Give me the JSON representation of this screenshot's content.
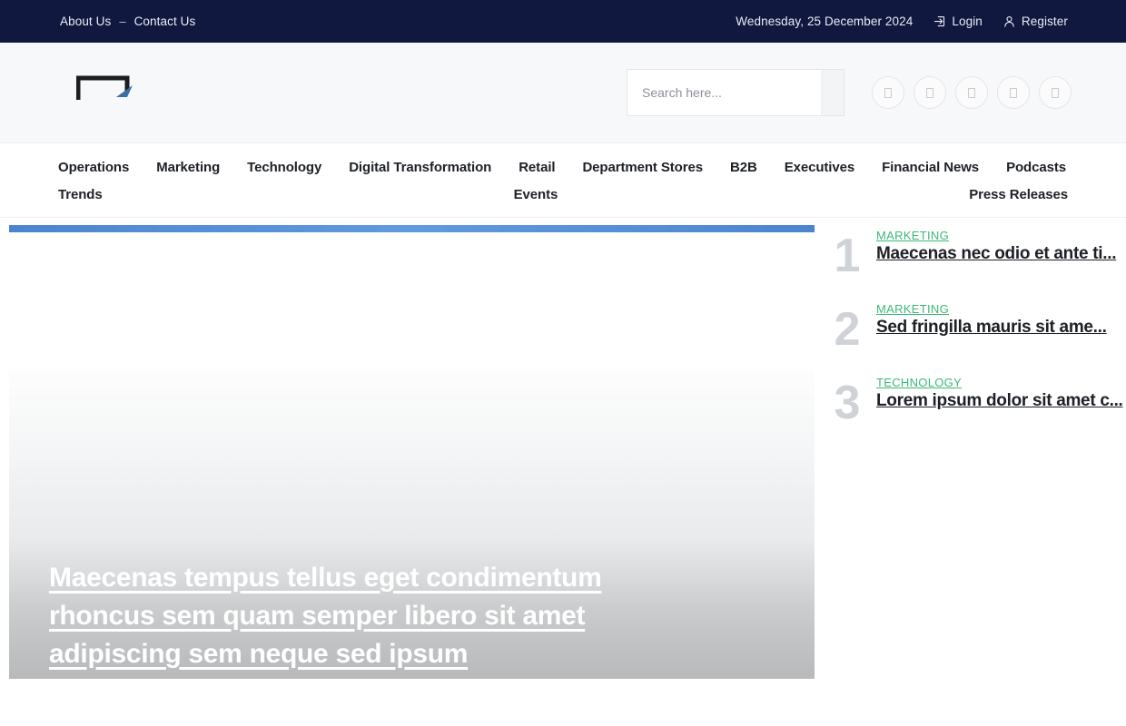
{
  "topbar": {
    "links": [
      {
        "label": "About Us",
        "name": "about-us-link"
      },
      {
        "label": "Contact Us",
        "name": "contact-us-link"
      }
    ],
    "separator": "–",
    "date": "Wednesday, 25 December 2024",
    "login_label": "Login",
    "login_icon": "sign-in-icon",
    "register_label": "Register",
    "register_icon": "user-icon",
    "background_color": "#101840"
  },
  "header": {
    "logo_name": "site-logo",
    "search": {
      "placeholder": "Search here...",
      "value": "",
      "button_icon": "search-icon"
    },
    "socials": [
      {
        "name": "social-icon-1"
      },
      {
        "name": "social-icon-2"
      },
      {
        "name": "social-icon-3"
      },
      {
        "name": "social-icon-4"
      },
      {
        "name": "social-icon-5"
      }
    ]
  },
  "nav": {
    "row1": [
      "Operations",
      "Marketing",
      "Technology",
      "Digital Transformation",
      "Retail",
      "Department Stores",
      "B2B",
      "Executives",
      "Financial News",
      "Podcasts"
    ],
    "row2": [
      "Trends",
      "Events",
      "Press Releases"
    ]
  },
  "hero": {
    "progress_color": "#4a8ad4",
    "title": "Maecenas tempus tellus eget condimentum rhoncus sem quam semper libero sit amet adipiscing sem neque sed ipsum"
  },
  "trending": {
    "accent_color": "#3cb878",
    "items": [
      {
        "rank": "1",
        "category": "MARKETING",
        "title": "Maecenas nec odio et ante ti..."
      },
      {
        "rank": "2",
        "category": "MARKETING",
        "title": "Sed fringilla mauris sit ame..."
      },
      {
        "rank": "3",
        "category": "TECHNOLOGY",
        "title": "Lorem ipsum dolor sit amet c..."
      }
    ]
  }
}
